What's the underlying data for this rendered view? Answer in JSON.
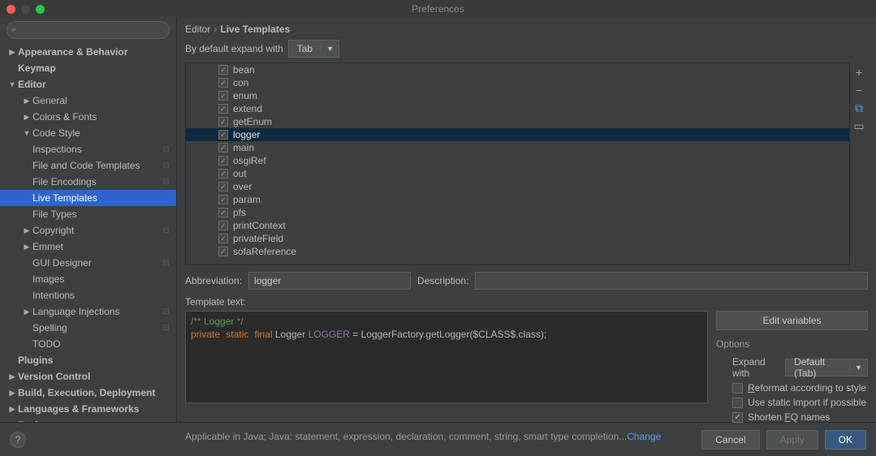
{
  "window": {
    "title": "Preferences"
  },
  "breadcrumb": {
    "a": "Editor",
    "b": "Live Templates"
  },
  "expand": {
    "label": "By default expand with",
    "value": "Tab"
  },
  "search": {
    "placeholder": ""
  },
  "sidebar": [
    {
      "label": "Appearance & Behavior",
      "level": 0,
      "arrow": "▶",
      "bold": true
    },
    {
      "label": "Keymap",
      "level": 0,
      "arrow": "",
      "bold": true
    },
    {
      "label": "Editor",
      "level": 0,
      "arrow": "▼",
      "bold": true
    },
    {
      "label": "General",
      "level": 1,
      "arrow": "▶"
    },
    {
      "label": "Colors & Fonts",
      "level": 1,
      "arrow": "▶"
    },
    {
      "label": "Code Style",
      "level": 1,
      "arrow": "▼"
    },
    {
      "label": "Inspections",
      "level": 1,
      "arrow": "",
      "cfg": true
    },
    {
      "label": "File and Code Templates",
      "level": 1,
      "arrow": "",
      "cfg": true
    },
    {
      "label": "File Encodings",
      "level": 1,
      "arrow": "",
      "cfg": true
    },
    {
      "label": "Live Templates",
      "level": 1,
      "arrow": "",
      "sel": true
    },
    {
      "label": "File Types",
      "level": 1,
      "arrow": ""
    },
    {
      "label": "Copyright",
      "level": 1,
      "arrow": "▶",
      "cfg": true
    },
    {
      "label": "Emmet",
      "level": 1,
      "arrow": "▶"
    },
    {
      "label": "GUI Designer",
      "level": 1,
      "arrow": "",
      "cfg": true
    },
    {
      "label": "Images",
      "level": 1,
      "arrow": ""
    },
    {
      "label": "Intentions",
      "level": 1,
      "arrow": ""
    },
    {
      "label": "Language Injections",
      "level": 1,
      "arrow": "▶",
      "cfg": true
    },
    {
      "label": "Spelling",
      "level": 1,
      "arrow": "",
      "cfg": true
    },
    {
      "label": "TODO",
      "level": 1,
      "arrow": ""
    },
    {
      "label": "Plugins",
      "level": 0,
      "arrow": "",
      "bold": true
    },
    {
      "label": "Version Control",
      "level": 0,
      "arrow": "▶",
      "bold": true
    },
    {
      "label": "Build, Execution, Deployment",
      "level": 0,
      "arrow": "▶",
      "bold": true
    },
    {
      "label": "Languages & Frameworks",
      "level": 0,
      "arrow": "▶",
      "bold": true
    },
    {
      "label": "Tools",
      "level": 0,
      "arrow": "▶",
      "bold": true
    }
  ],
  "templates": [
    {
      "name": "bean"
    },
    {
      "name": "con"
    },
    {
      "name": "enum"
    },
    {
      "name": "extend"
    },
    {
      "name": "getEnum"
    },
    {
      "name": "logger",
      "sel": true
    },
    {
      "name": "main"
    },
    {
      "name": "osgiRef"
    },
    {
      "name": "out"
    },
    {
      "name": "over"
    },
    {
      "name": "param"
    },
    {
      "name": "pfs"
    },
    {
      "name": "printContext"
    },
    {
      "name": "privateField"
    },
    {
      "name": "sofaReference"
    }
  ],
  "abbr": {
    "label": "Abbreviation:",
    "value": "logger"
  },
  "desc": {
    "label": "Description:",
    "value": ""
  },
  "tplt": {
    "label": "Template text:"
  },
  "code": {
    "l1": "/** Logger */",
    "l2a": "private",
    "l2b": "static",
    "l2c": "final",
    "l2d": " Logger ",
    "l2e": "LOGGER",
    "l2f": " = LoggerFactory.getLogger(",
    "l2g": "$CLASS$",
    "l2h": ".class);"
  },
  "editvars": {
    "label": "Edit variables"
  },
  "options": {
    "label": "Options",
    "expand": {
      "label": "Expand with",
      "value": "Default (Tab)"
    },
    "reformat": "Reformat according to style",
    "staticimport": "Use static import if possible",
    "shorten": "Shorten FQ names"
  },
  "applicable": {
    "text": "Applicable in Java; Java: statement, expression, declaration, comment, string, smart type completion...",
    "change": "Change"
  },
  "footer": {
    "cancel": "Cancel",
    "apply": "Apply",
    "ok": "OK",
    "help": "?"
  }
}
